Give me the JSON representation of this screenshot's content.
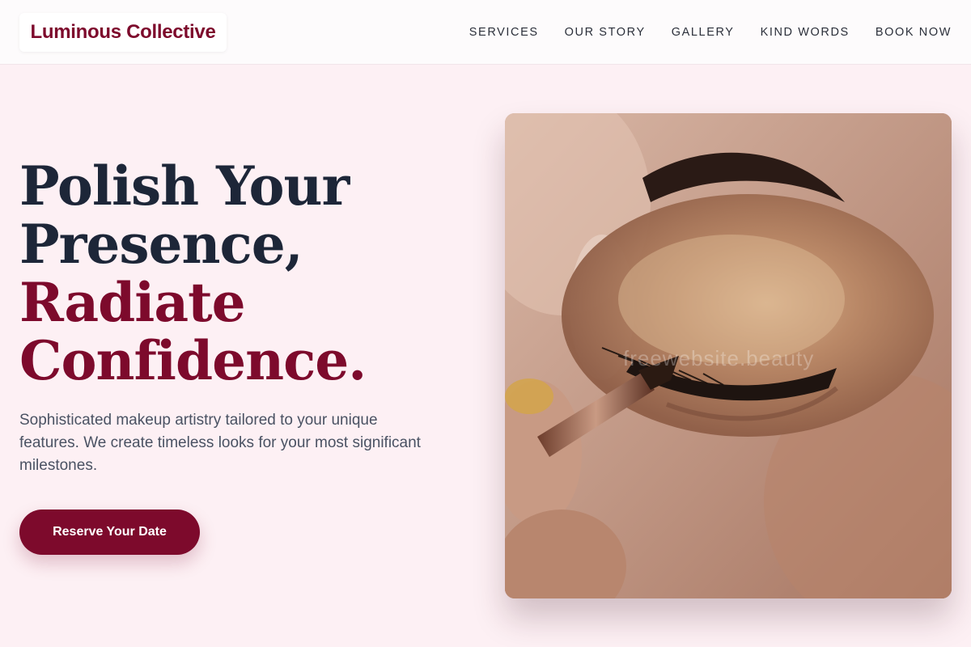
{
  "header": {
    "brand": "Luminous Collective",
    "nav": [
      {
        "label": "SERVICES"
      },
      {
        "label": "OUR STORY"
      },
      {
        "label": "GALLERY"
      },
      {
        "label": "KIND WORDS"
      },
      {
        "label": "BOOK NOW"
      }
    ]
  },
  "hero": {
    "title_lines": [
      "Polish Your",
      "Presence,",
      "Radiate",
      "Confidence."
    ],
    "description": "Sophisticated makeup artistry tailored to your unique features. We create timeless looks for your most significant milestones.",
    "cta_label": "Reserve Your Date",
    "image": {
      "subject": "eye-makeup-closeup",
      "watermark": "freewebsite.beauty"
    }
  },
  "colors": {
    "brand": "#7d0a2c",
    "heading_dark": "#1d2638",
    "page_background": "#fdf0f4",
    "header_background": "#fdfbfc",
    "body_text": "#4a5263"
  }
}
